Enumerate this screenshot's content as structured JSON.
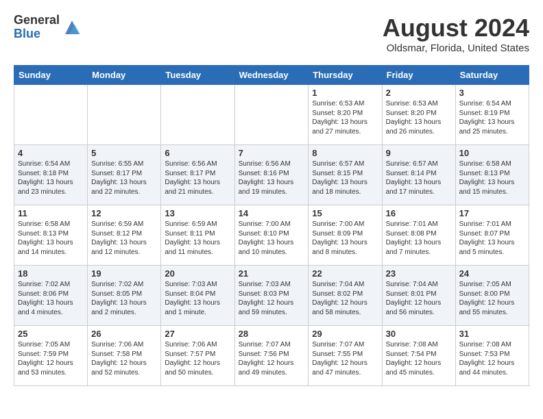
{
  "header": {
    "logo_general": "General",
    "logo_blue": "Blue",
    "month_title": "August 2024",
    "location": "Oldsmar, Florida, United States"
  },
  "days_of_week": [
    "Sunday",
    "Monday",
    "Tuesday",
    "Wednesday",
    "Thursday",
    "Friday",
    "Saturday"
  ],
  "weeks": [
    [
      {
        "day": "",
        "info": ""
      },
      {
        "day": "",
        "info": ""
      },
      {
        "day": "",
        "info": ""
      },
      {
        "day": "",
        "info": ""
      },
      {
        "day": "1",
        "info": "Sunrise: 6:53 AM\nSunset: 8:20 PM\nDaylight: 13 hours\nand 27 minutes."
      },
      {
        "day": "2",
        "info": "Sunrise: 6:53 AM\nSunset: 8:20 PM\nDaylight: 13 hours\nand 26 minutes."
      },
      {
        "day": "3",
        "info": "Sunrise: 6:54 AM\nSunset: 8:19 PM\nDaylight: 13 hours\nand 25 minutes."
      }
    ],
    [
      {
        "day": "4",
        "info": "Sunrise: 6:54 AM\nSunset: 8:18 PM\nDaylight: 13 hours\nand 23 minutes."
      },
      {
        "day": "5",
        "info": "Sunrise: 6:55 AM\nSunset: 8:17 PM\nDaylight: 13 hours\nand 22 minutes."
      },
      {
        "day": "6",
        "info": "Sunrise: 6:56 AM\nSunset: 8:17 PM\nDaylight: 13 hours\nand 21 minutes."
      },
      {
        "day": "7",
        "info": "Sunrise: 6:56 AM\nSunset: 8:16 PM\nDaylight: 13 hours\nand 19 minutes."
      },
      {
        "day": "8",
        "info": "Sunrise: 6:57 AM\nSunset: 8:15 PM\nDaylight: 13 hours\nand 18 minutes."
      },
      {
        "day": "9",
        "info": "Sunrise: 6:57 AM\nSunset: 8:14 PM\nDaylight: 13 hours\nand 17 minutes."
      },
      {
        "day": "10",
        "info": "Sunrise: 6:58 AM\nSunset: 8:13 PM\nDaylight: 13 hours\nand 15 minutes."
      }
    ],
    [
      {
        "day": "11",
        "info": "Sunrise: 6:58 AM\nSunset: 8:13 PM\nDaylight: 13 hours\nand 14 minutes."
      },
      {
        "day": "12",
        "info": "Sunrise: 6:59 AM\nSunset: 8:12 PM\nDaylight: 13 hours\nand 12 minutes."
      },
      {
        "day": "13",
        "info": "Sunrise: 6:59 AM\nSunset: 8:11 PM\nDaylight: 13 hours\nand 11 minutes."
      },
      {
        "day": "14",
        "info": "Sunrise: 7:00 AM\nSunset: 8:10 PM\nDaylight: 13 hours\nand 10 minutes."
      },
      {
        "day": "15",
        "info": "Sunrise: 7:00 AM\nSunset: 8:09 PM\nDaylight: 13 hours\nand 8 minutes."
      },
      {
        "day": "16",
        "info": "Sunrise: 7:01 AM\nSunset: 8:08 PM\nDaylight: 13 hours\nand 7 minutes."
      },
      {
        "day": "17",
        "info": "Sunrise: 7:01 AM\nSunset: 8:07 PM\nDaylight: 13 hours\nand 5 minutes."
      }
    ],
    [
      {
        "day": "18",
        "info": "Sunrise: 7:02 AM\nSunset: 8:06 PM\nDaylight: 13 hours\nand 4 minutes."
      },
      {
        "day": "19",
        "info": "Sunrise: 7:02 AM\nSunset: 8:05 PM\nDaylight: 13 hours\nand 2 minutes."
      },
      {
        "day": "20",
        "info": "Sunrise: 7:03 AM\nSunset: 8:04 PM\nDaylight: 13 hours\nand 1 minute."
      },
      {
        "day": "21",
        "info": "Sunrise: 7:03 AM\nSunset: 8:03 PM\nDaylight: 12 hours\nand 59 minutes."
      },
      {
        "day": "22",
        "info": "Sunrise: 7:04 AM\nSunset: 8:02 PM\nDaylight: 12 hours\nand 58 minutes."
      },
      {
        "day": "23",
        "info": "Sunrise: 7:04 AM\nSunset: 8:01 PM\nDaylight: 12 hours\nand 56 minutes."
      },
      {
        "day": "24",
        "info": "Sunrise: 7:05 AM\nSunset: 8:00 PM\nDaylight: 12 hours\nand 55 minutes."
      }
    ],
    [
      {
        "day": "25",
        "info": "Sunrise: 7:05 AM\nSunset: 7:59 PM\nDaylight: 12 hours\nand 53 minutes."
      },
      {
        "day": "26",
        "info": "Sunrise: 7:06 AM\nSunset: 7:58 PM\nDaylight: 12 hours\nand 52 minutes."
      },
      {
        "day": "27",
        "info": "Sunrise: 7:06 AM\nSunset: 7:57 PM\nDaylight: 12 hours\nand 50 minutes."
      },
      {
        "day": "28",
        "info": "Sunrise: 7:07 AM\nSunset: 7:56 PM\nDaylight: 12 hours\nand 49 minutes."
      },
      {
        "day": "29",
        "info": "Sunrise: 7:07 AM\nSunset: 7:55 PM\nDaylight: 12 hours\nand 47 minutes."
      },
      {
        "day": "30",
        "info": "Sunrise: 7:08 AM\nSunset: 7:54 PM\nDaylight: 12 hours\nand 45 minutes."
      },
      {
        "day": "31",
        "info": "Sunrise: 7:08 AM\nSunset: 7:53 PM\nDaylight: 12 hours\nand 44 minutes."
      }
    ]
  ]
}
